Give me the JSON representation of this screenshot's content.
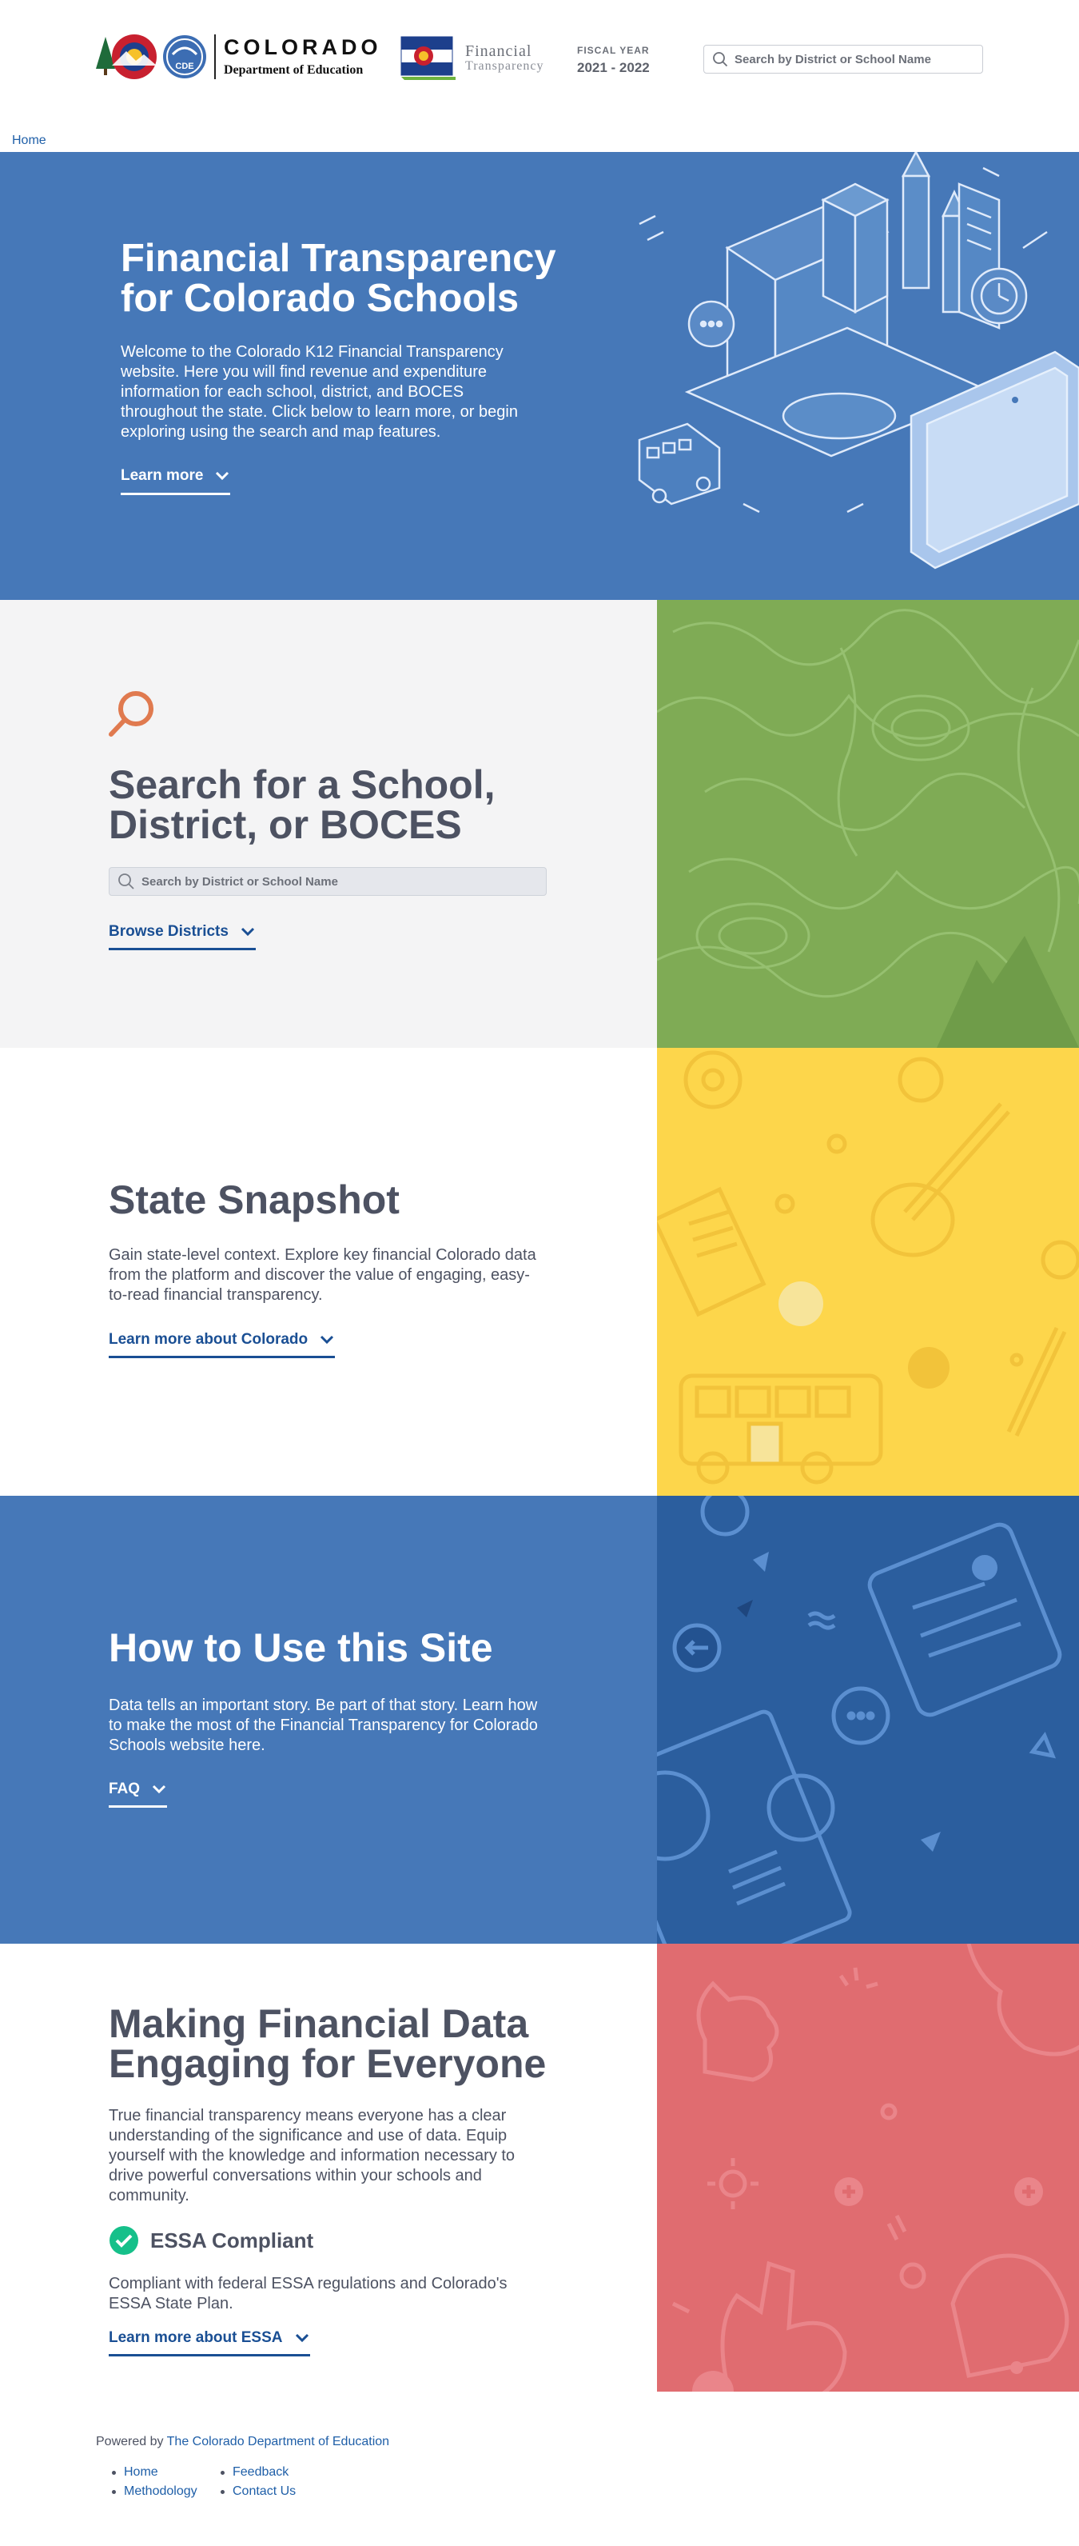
{
  "header": {
    "colorado_title": "COLORADO",
    "department": "Department of Education",
    "cde_badge": "CDE",
    "ft_word1": "Financial",
    "ft_word2": "Transparency",
    "fiscal_year_label": "FISCAL YEAR",
    "fiscal_year_value": "2021 - 2022",
    "search_placeholder": "Search by District or School Name"
  },
  "breadcrumb": {
    "home": "Home"
  },
  "hero": {
    "title": "Financial Transparency for Colorado Schools",
    "text": "Welcome to the Colorado K12 Financial Transparency website. Here you will find revenue and expenditure information for each school, district, and BOCES throughout the state. Click below to learn more, or begin exploring using the search and map features.",
    "learn_more": "Learn more",
    "illustration_icons": [
      "school-building-icon",
      "books-icon",
      "bus-icon",
      "laptop-icon",
      "chat-bubble-icon",
      "pencil-icon"
    ]
  },
  "search_section": {
    "title": "Search for a School, District, or BOCES",
    "placeholder": "Search by District or School Name",
    "browse": "Browse Districts",
    "bg_color": "#7fab55"
  },
  "snapshot": {
    "title": "State Snapshot",
    "text": "Gain state-level context. Explore key financial Colorado data from the platform and discover the value of engaging, easy-to-read financial transparency.",
    "link": "Learn more about Colorado",
    "bg_color": "#fdd64b"
  },
  "howto": {
    "title": "How to Use this Site",
    "text": "Data tells an important story. Be part of that story. Learn how to make the most of the Financial Transparency for Colorado Schools website here.",
    "link": "FAQ",
    "bg_color": "#2b5e9e"
  },
  "engage": {
    "title": "Making Financial Data Engaging for Everyone",
    "text": "True financial transparency means everyone has a clear understanding of the significance and use of data. Equip yourself with the knowledge and information necessary to drive powerful conversations within your schools and community.",
    "essa_title": "ESSA Compliant",
    "essa_text": "Compliant with federal ESSA regulations and Colorado's ESSA State Plan.",
    "link": "Learn more about ESSA",
    "bg_color": "#e06c70"
  },
  "footer": {
    "powered_prefix": "Powered by ",
    "powered_link": "The Colorado Department of Education",
    "links": [
      "Home",
      "Feedback",
      "Methodology",
      "Contact Us"
    ]
  },
  "colors": {
    "primary_blue": "#4678b8",
    "link_blue": "#1a4f94",
    "heading_gray": "#4d5262",
    "accent_orange": "#e07a4f",
    "essa_green": "#16c08a"
  }
}
